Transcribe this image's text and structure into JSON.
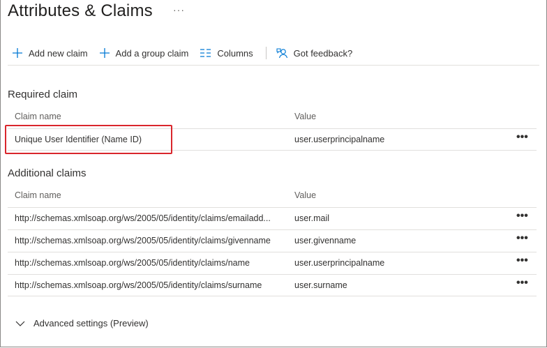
{
  "header": {
    "title": "Attributes & Claims",
    "more": "···"
  },
  "toolbar": {
    "add_claim": "Add new claim",
    "add_group_claim": "Add a group claim",
    "columns": "Columns",
    "feedback": "Got feedback?"
  },
  "required": {
    "section_title": "Required claim",
    "col_name": "Claim name",
    "col_value": "Value",
    "rows": [
      {
        "name": "Unique User Identifier (Name ID)",
        "value": "user.userprincipalname",
        "more": "•••"
      }
    ]
  },
  "additional": {
    "section_title": "Additional claims",
    "col_name": "Claim name",
    "col_value": "Value",
    "rows": [
      {
        "name": "http://schemas.xmlsoap.org/ws/2005/05/identity/claims/emailadd...",
        "value": "user.mail",
        "more": "•••"
      },
      {
        "name": "http://schemas.xmlsoap.org/ws/2005/05/identity/claims/givenname",
        "value": "user.givenname",
        "more": "•••"
      },
      {
        "name": "http://schemas.xmlsoap.org/ws/2005/05/identity/claims/name",
        "value": "user.userprincipalname",
        "more": "•••"
      },
      {
        "name": "http://schemas.xmlsoap.org/ws/2005/05/identity/claims/surname",
        "value": "user.surname",
        "more": "•••"
      }
    ]
  },
  "advanced": {
    "label": "Advanced settings (Preview)"
  },
  "colors": {
    "accent": "#0078d4",
    "highlight": "#d9262c"
  }
}
